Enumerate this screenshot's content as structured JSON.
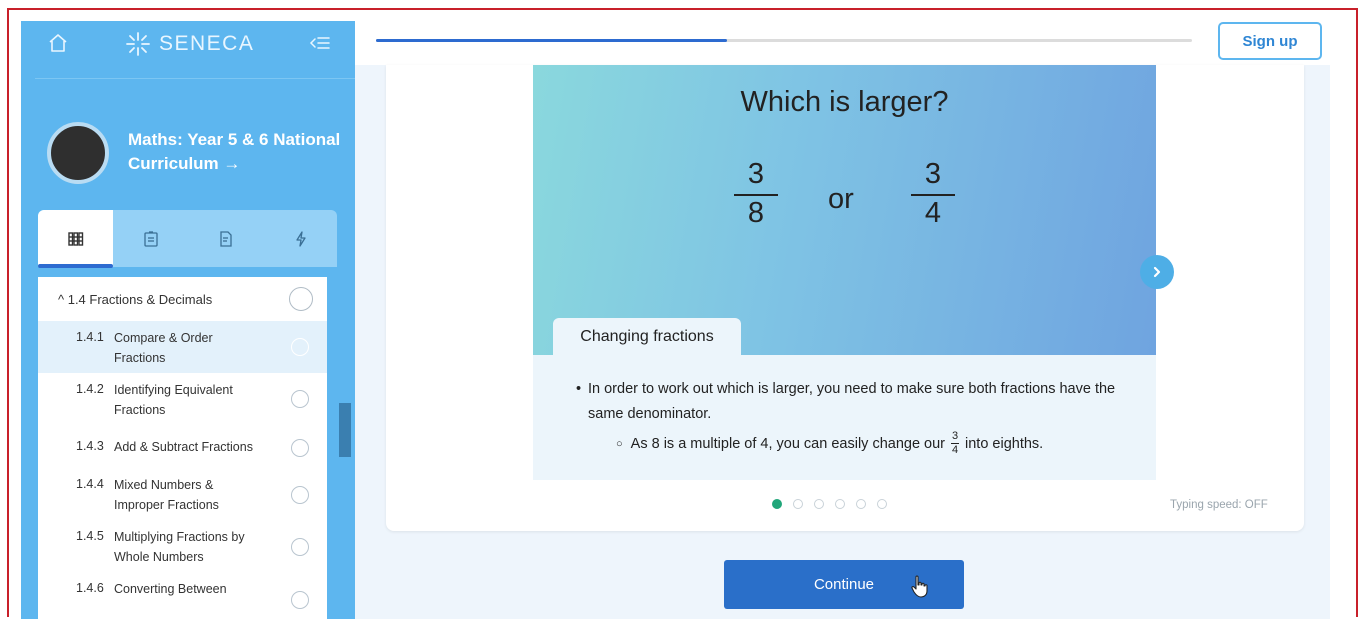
{
  "app": {
    "logo_text": "SENECA"
  },
  "course": {
    "title": "Maths: Year 5 & 6 National Curriculum →"
  },
  "sidebar": {
    "tabs": [
      {
        "icon": "books-icon",
        "active": true
      },
      {
        "icon": "notes-icon",
        "active": false
      },
      {
        "icon": "document-icon",
        "active": false
      },
      {
        "icon": "lightning-icon",
        "active": false
      }
    ],
    "section": {
      "label": "^ 1.4 Fractions & Decimals"
    },
    "items": [
      {
        "num": "1.4.1",
        "label": "Compare & Order Fractions",
        "active": true
      },
      {
        "num": "1.4.2",
        "label": "Identifying Equivalent Fractions",
        "active": false
      },
      {
        "num": "1.4.3",
        "label": "Add & Subtract Fractions",
        "active": false
      },
      {
        "num": "1.4.4",
        "label": "Mixed Numbers & Improper Fractions",
        "active": false
      },
      {
        "num": "1.4.5",
        "label": "Multiplying Fractions by Whole Numbers",
        "active": false
      },
      {
        "num": "1.4.6",
        "label": "Converting Between",
        "active": false
      }
    ]
  },
  "header": {
    "signup_label": "Sign up",
    "progress": 0.43
  },
  "card": {
    "question": "Which is larger?",
    "fraction_a": {
      "numerator": "3",
      "denominator": "8"
    },
    "or_word": "or",
    "fraction_b": {
      "numerator": "3",
      "denominator": "4"
    },
    "info_title": "Changing fractions",
    "bullet_1": "In order to work out which is larger, you need to make sure both fractions have the same denominator.",
    "bullet_2_before": "As 8 is a multiple of 4, you can easily change our",
    "bullet_2_frac": {
      "numerator": "3",
      "denominator": "4"
    },
    "bullet_2_after": "into eighths.",
    "dots_total": 6,
    "dots_active": 1,
    "typing_speed": "Typing speed: OFF"
  },
  "footer": {
    "continue_label": "Continue"
  },
  "colors": {
    "sidebar": "#5db6ef",
    "accent": "#2a6fc9",
    "dot_active": "#21a67a"
  }
}
